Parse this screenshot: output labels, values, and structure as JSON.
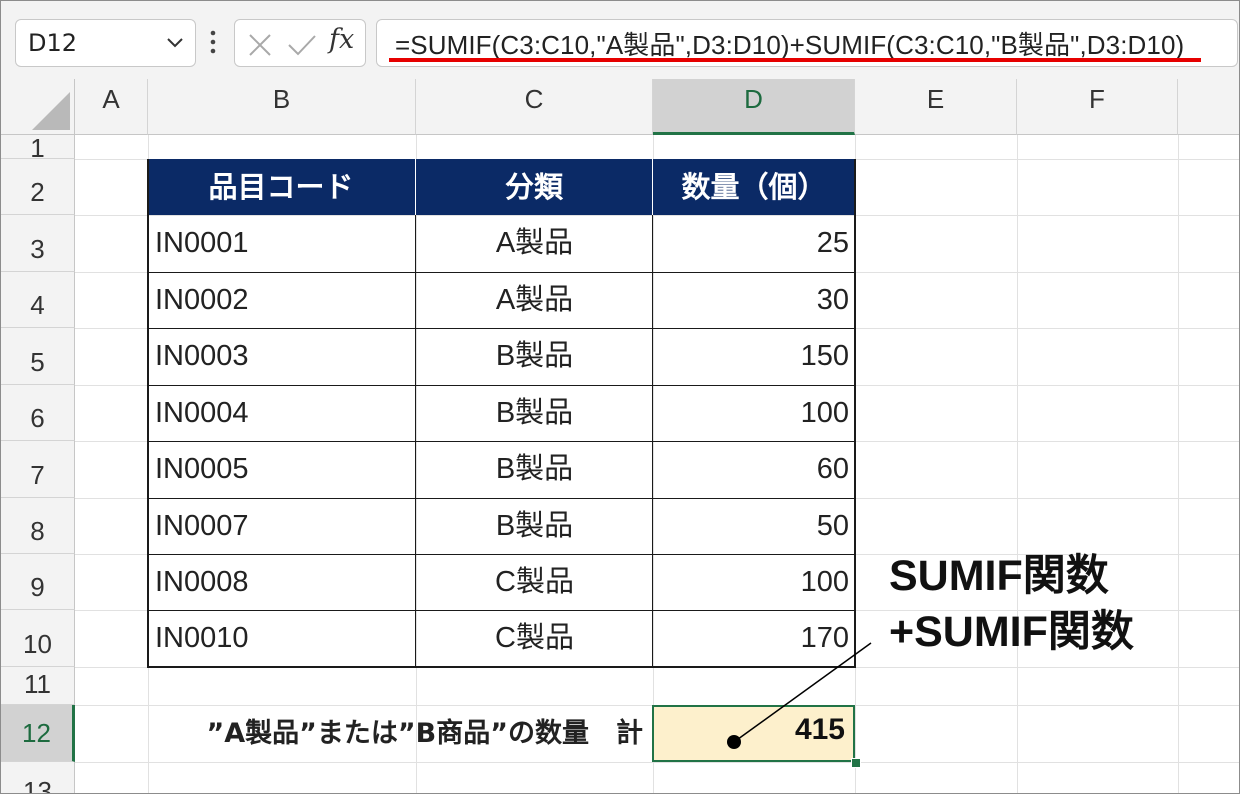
{
  "formula_bar": {
    "name_box": "D12",
    "cancel_icon": "close-icon",
    "enter_icon": "checkmark-icon",
    "fx_label": "fx",
    "formula": "=SUMIF(C3:C10,\"A製品\",D3:D10)+SUMIF(C3:C10,\"B製品\",D3:D10)",
    "underline_color": "#e60000"
  },
  "columns": [
    "A",
    "B",
    "C",
    "D",
    "E",
    "F"
  ],
  "selected_column": "D",
  "rows": [
    "1",
    "2",
    "3",
    "4",
    "5",
    "6",
    "7",
    "8",
    "9",
    "10",
    "11",
    "12",
    "13"
  ],
  "selected_row": "12",
  "table": {
    "headers": [
      "品目コード",
      "分類",
      "数量（個）"
    ],
    "header_bg": "#0b2a66",
    "rows": [
      {
        "code": "IN0001",
        "category": "A製品",
        "qty": "25"
      },
      {
        "code": "IN0002",
        "category": "A製品",
        "qty": "30"
      },
      {
        "code": "IN0003",
        "category": "B製品",
        "qty": "150"
      },
      {
        "code": "IN0004",
        "category": "B製品",
        "qty": "100"
      },
      {
        "code": "IN0005",
        "category": "B製品",
        "qty": "60"
      },
      {
        "code": "IN0007",
        "category": "B製品",
        "qty": "50"
      },
      {
        "code": "IN0008",
        "category": "C製品",
        "qty": "100"
      },
      {
        "code": "IN0010",
        "category": "C製品",
        "qty": "170"
      }
    ]
  },
  "summary": {
    "label": "”A製品”または”B商品”の数量　計",
    "value": "415",
    "cell_bg": "#fdf0cc"
  },
  "annotation": {
    "line1": "SUMIF関数",
    "line2": "+SUMIF関数"
  }
}
